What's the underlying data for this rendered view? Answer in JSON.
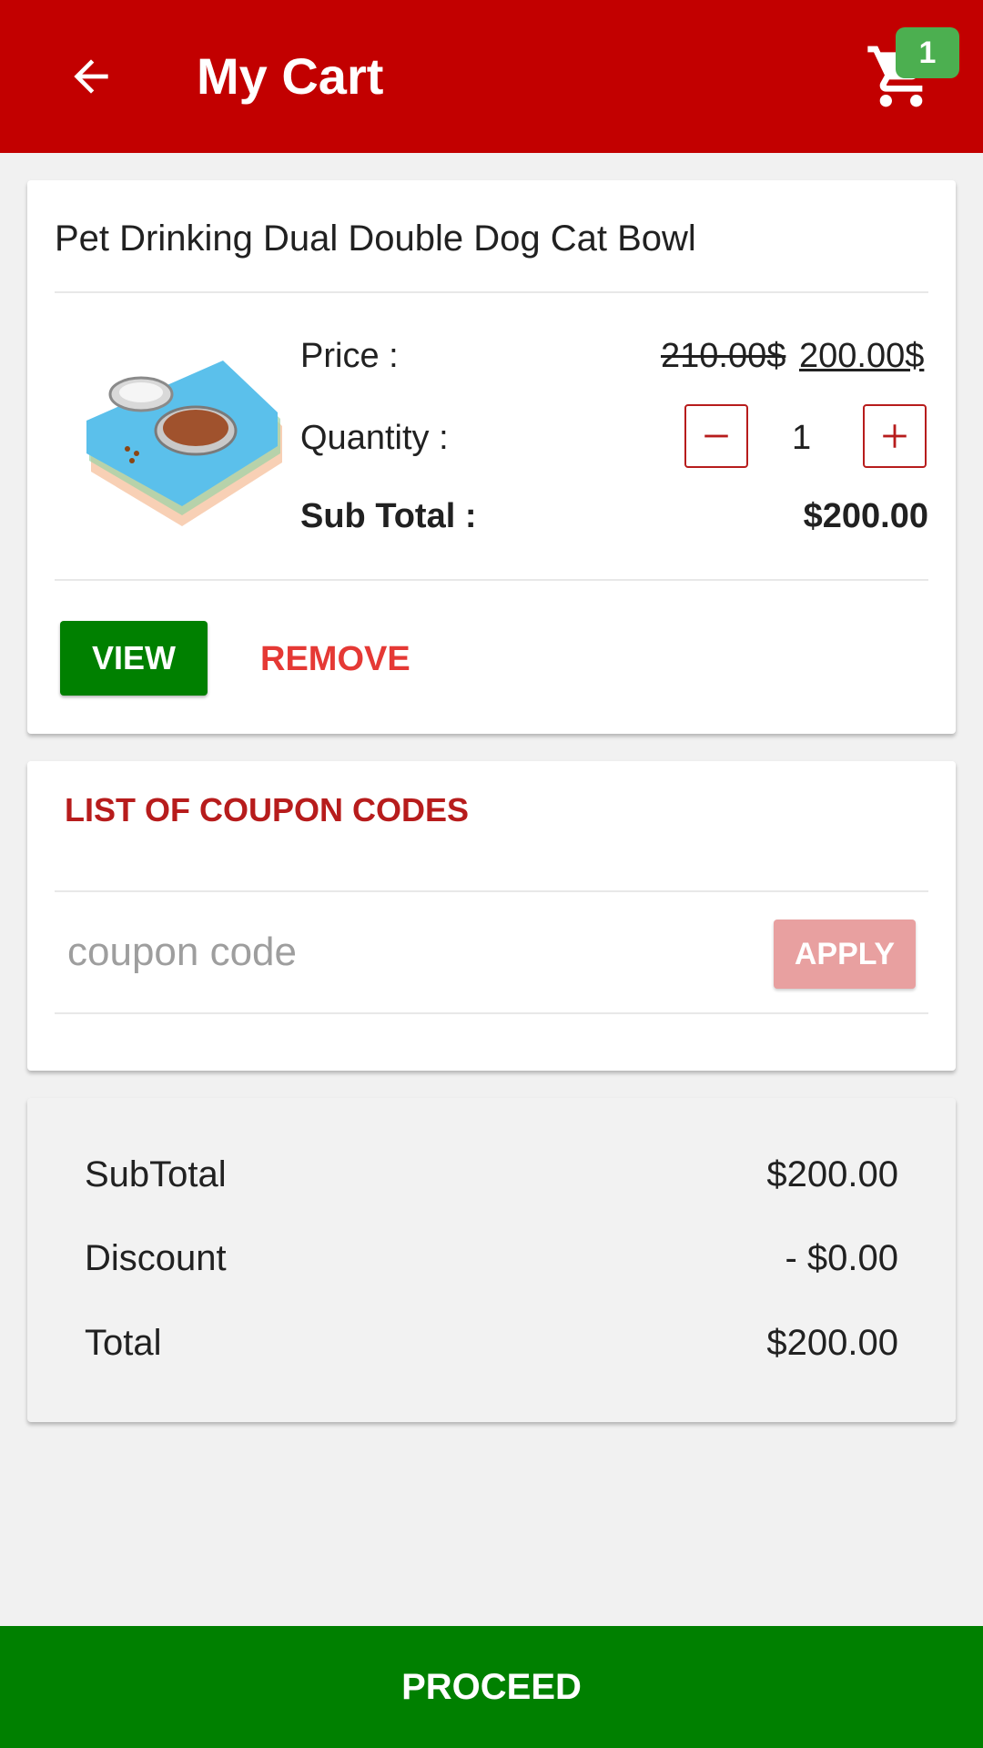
{
  "header": {
    "title": "My Cart",
    "cart_count": "1"
  },
  "cart_item": {
    "name": "Pet Drinking Dual Double Dog Cat Bowl",
    "price_label": "Price :",
    "price_old": "210.00$",
    "price_new": "200.00$",
    "quantity_label": "Quantity :",
    "quantity": "1",
    "subtotal_label": "Sub Total :",
    "subtotal_value": "$200.00",
    "view_label": "VIEW",
    "remove_label": "REMOVE"
  },
  "coupon": {
    "title": "LIST OF COUPON CODES",
    "placeholder": "coupon code",
    "apply_label": "APPLY"
  },
  "summary": {
    "subtotal_label": "SubTotal",
    "subtotal_value": "$200.00",
    "discount_label": "Discount",
    "discount_value": "- $0.00",
    "total_label": "Total",
    "total_value": "$200.00"
  },
  "footer": {
    "proceed_label": "PROCEED"
  },
  "colors": {
    "primary_red": "#c20000",
    "badge_green": "#4caf50",
    "button_green": "#008000",
    "remove_red": "#e53935",
    "apply_disabled": "#e8a0a0"
  },
  "icons": {
    "back": "arrow-left-icon",
    "cart": "shopping-cart-icon",
    "minus": "minus-icon",
    "plus": "plus-icon"
  }
}
